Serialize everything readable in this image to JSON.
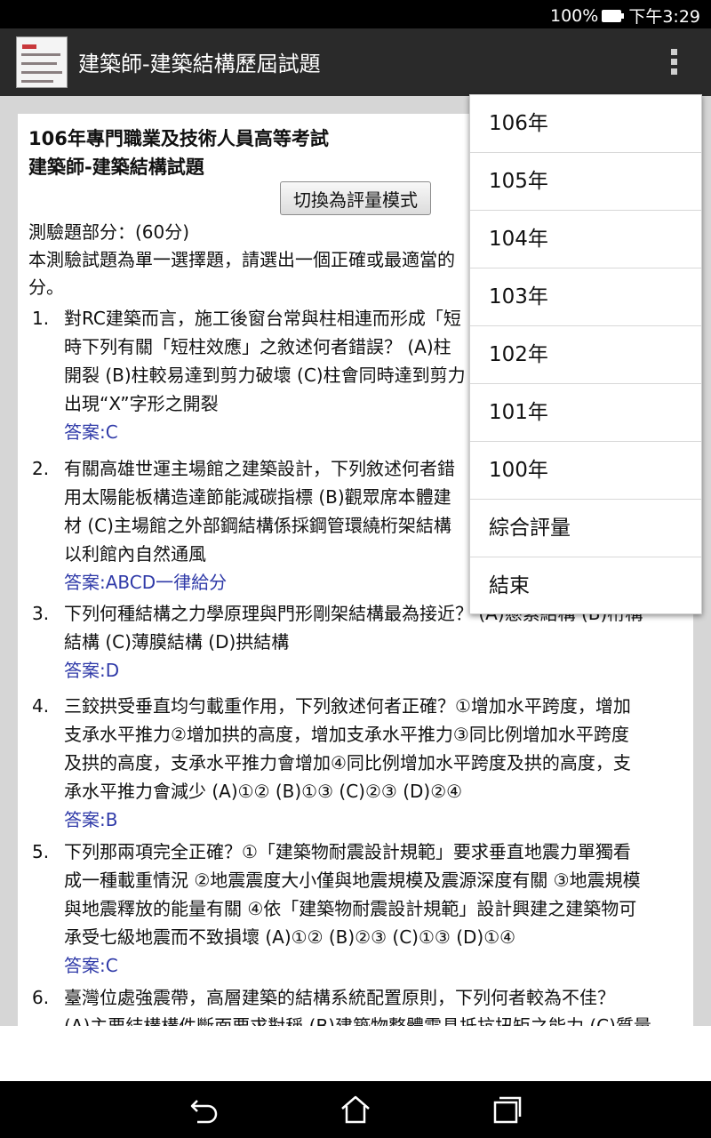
{
  "status_bar": {
    "battery": "100%",
    "time": "下午3:29"
  },
  "app_bar": {
    "title": "建築師-建築結構歷屆試題"
  },
  "exam": {
    "title_line1": "106年專門職業及技術人員高等考試",
    "title_line2": "建築師-建築結構試題",
    "mode_button": "切換為評量模式",
    "intro_lines": [
      "測驗題部分：(60分)",
      "本測驗試題為單一選擇題，請選出一個正確或最適當的",
      "分。"
    ]
  },
  "questions": [
    {
      "number": "1.",
      "lines": [
        "對RC建築而言，施工後窗台常與柱相連而形成「短",
        "時下列有關「短柱效應」之敘述何者錯誤？ (A)柱",
        "開裂 (B)柱較易達到剪力破壞 (C)柱會同時達到剪力",
        "出現“X”字形之開裂"
      ],
      "answer": "答案:C"
    },
    {
      "number": "2.",
      "lines": [
        "有關高雄世運主場館之建築設計，下列敘述何者錯",
        "用太陽能板構造達節能減碳指標 (B)觀眾席本體建",
        "材 (C)主場館之外部鋼結構係採鋼管環繞桁架結構",
        "以利館內自然通風"
      ],
      "answer": "答案:ABCD一律給分"
    },
    {
      "number": "3.",
      "lines": [
        "下列何種結構之力學原理與門形剛架結構最為接近？ (A)懸索結構 (B)桁構",
        "結構 (C)薄膜結構 (D)拱結構"
      ],
      "answer": "答案:D"
    },
    {
      "number": "4.",
      "lines": [
        "三鉸拱受垂直均勻載重作用，下列敘述何者正確？①增加水平跨度，增加",
        "支承水平推力②增加拱的高度，增加支承水平推力③同比例增加水平跨度",
        "及拱的高度，支承水平推力會增加④同比例增加水平跨度及拱的高度，支",
        "承水平推力會減少 (A)①② (B)①③ (C)②③ (D)②④"
      ],
      "answer": "答案:B"
    },
    {
      "number": "5.",
      "lines": [
        "下列那兩項完全正確？①「建築物耐震設計規範」要求垂直地震力單獨看",
        "成一種載重情況 ②地震震度大小僅與地震規模及震源深度有關 ③地震規模",
        "與地震釋放的能量有關 ④依「建築物耐震設計規範」設計興建之建築物可",
        "承受七級地震而不致損壞 (A)①② (B)②③ (C)①③ (D)①④"
      ],
      "answer": "答案:C"
    },
    {
      "number": "6.",
      "lines": [
        "臺灣位處強震帶，高層建築的結構系統配置原則，下列何者較為不佳？",
        "(A)主要結構構件斷面要求對稱 (B)建築物整體需具抵抗扭矩之能力 (C)質量"
      ],
      "answer": ""
    }
  ],
  "menu": {
    "items": [
      "106年",
      "105年",
      "104年",
      "103年",
      "102年",
      "101年",
      "100年",
      "綜合評量",
      "結束"
    ]
  },
  "nav": {
    "icons": [
      "back-icon",
      "home-icon",
      "recent-apps-icon"
    ]
  }
}
